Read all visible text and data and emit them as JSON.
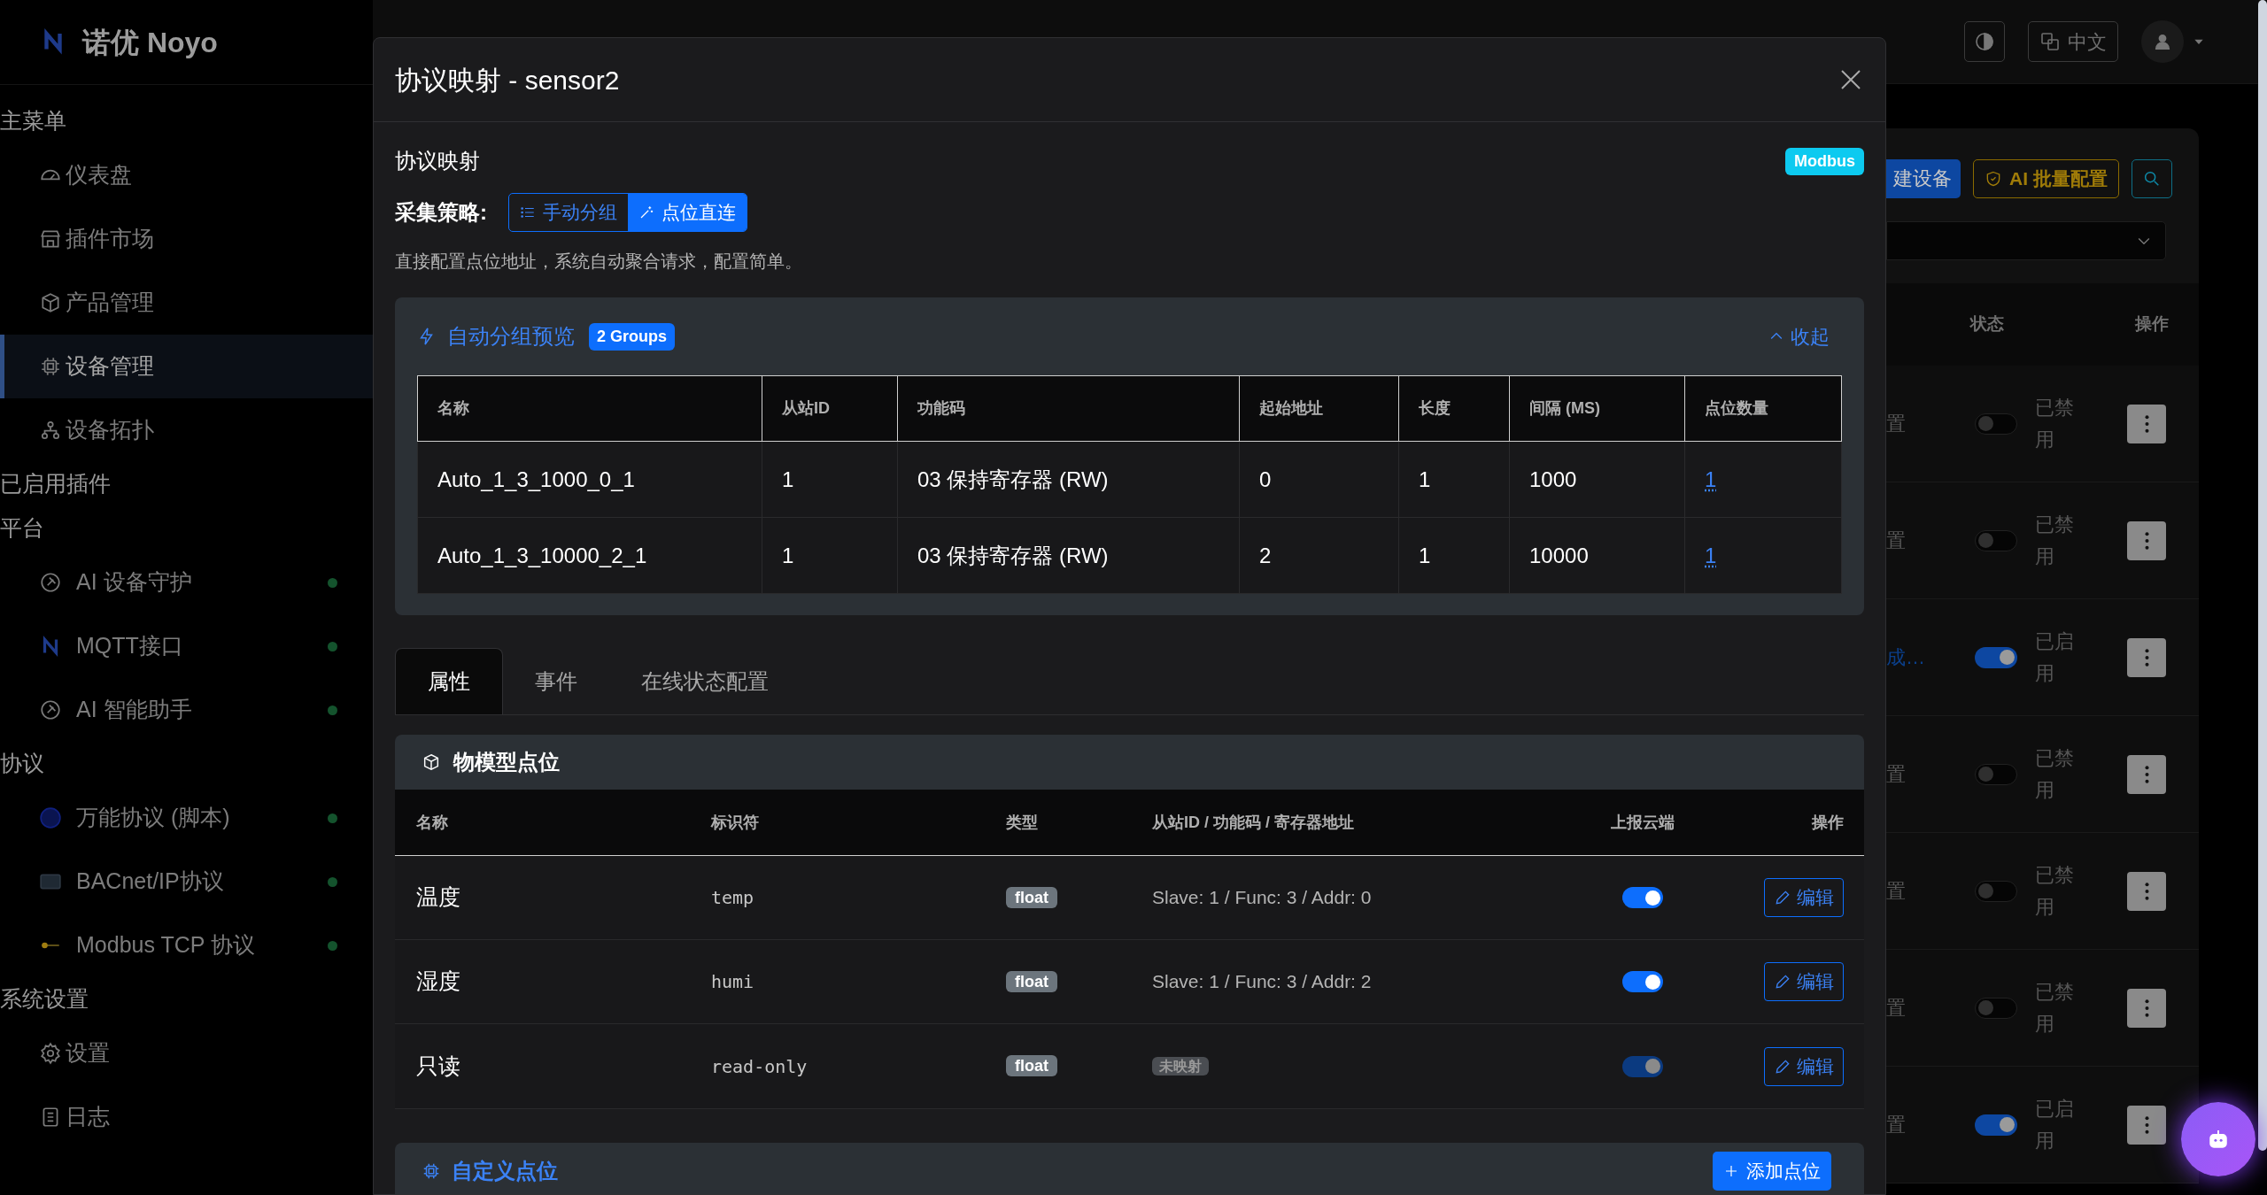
{
  "sidebar": {
    "brand": "诺优 Noyo",
    "sections": [
      {
        "title": "主菜单",
        "items": [
          {
            "label": "仪表盘",
            "selected": false
          },
          {
            "label": "插件市场",
            "selected": false
          },
          {
            "label": "产品管理",
            "selected": false
          },
          {
            "label": "设备管理",
            "selected": true
          },
          {
            "label": "设备拓扑",
            "selected": false
          }
        ]
      },
      {
        "title": "已启用插件"
      },
      {
        "title": "平台",
        "items": [
          {
            "label": "AI 设备守护",
            "selected": false,
            "online": true
          },
          {
            "label": "MQTT接口",
            "selected": false,
            "online": true
          },
          {
            "label": "AI 智能助手",
            "selected": false,
            "online": true
          }
        ]
      },
      {
        "title": "协议",
        "items": [
          {
            "label": "万能协议 (脚本)",
            "selected": false,
            "online": true
          },
          {
            "label": "BACnet/IP协议",
            "selected": false,
            "online": true
          },
          {
            "label": "Modbus TCP 协议",
            "selected": false,
            "online": true
          }
        ]
      },
      {
        "title": "系统设置",
        "items": [
          {
            "label": "设置",
            "selected": false
          },
          {
            "label": "日志",
            "selected": false
          }
        ]
      }
    ]
  },
  "topbar": {
    "language": "中文"
  },
  "device_page": {
    "buttons": [
      {
        "label": "建设备",
        "kind": "primary"
      },
      {
        "label": "AI 批量配置",
        "kind": "warning"
      }
    ],
    "columns": [
      "状态",
      "操作"
    ],
    "rows": [
      {
        "config": "置",
        "kind": "text",
        "status_on": false,
        "status": "已禁用"
      },
      {
        "config": "置",
        "kind": "text",
        "status_on": false,
        "status": "已禁用"
      },
      {
        "config": "成…",
        "kind": "link",
        "status_on": true,
        "status": "已启用"
      },
      {
        "config": "置",
        "kind": "text",
        "status_on": false,
        "status": "已禁用"
      },
      {
        "config": "置",
        "kind": "text",
        "status_on": false,
        "status": "已禁用"
      },
      {
        "config": "置",
        "kind": "text",
        "status_on": false,
        "status": "已禁用"
      },
      {
        "config": "置",
        "kind": "text",
        "status_on": true,
        "status": "已启用"
      }
    ]
  },
  "modal": {
    "title": "协议映射 - sensor2",
    "section_title": "协议映射",
    "protocol_badge": "Modbus",
    "strategy_label": "采集策略:",
    "strategies": [
      {
        "label": "手动分组",
        "selected": false
      },
      {
        "label": "点位直连",
        "selected": true
      }
    ],
    "description": "直接配置点位地址，系统自动聚合请求，配置简单。",
    "preview": {
      "title": "自动分组预览",
      "badge": "2 Groups",
      "collapse": "收起",
      "expanded": true,
      "columns": [
        "名称",
        "从站ID",
        "功能码",
        "起始地址",
        "长度",
        "间隔 (MS)",
        "点位数量"
      ],
      "rows": [
        [
          "Auto_1_3_1000_0_1",
          "1",
          "03 保持寄存器 (RW)",
          "0",
          "1",
          "1000",
          "1"
        ],
        [
          "Auto_1_3_10000_2_1",
          "1",
          "03 保持寄存器 (RW)",
          "2",
          "1",
          "10000",
          "1"
        ]
      ]
    },
    "tabs": [
      {
        "label": "属性",
        "selected": true
      },
      {
        "label": "事件",
        "selected": false
      },
      {
        "label": "在线状态配置",
        "selected": false
      }
    ],
    "points": {
      "title": "物模型点位",
      "columns": [
        "名称",
        "标识符",
        "类型",
        "从站ID / 功能码 / 寄存器地址",
        "上报云端",
        "操作"
      ],
      "rows": [
        {
          "name": "温度",
          "identifier": "temp",
          "type": "float",
          "mapping": "Slave: 1 / Func: 3 / Addr: 0",
          "mapped": true,
          "report": true,
          "disabled": false,
          "action": "编辑"
        },
        {
          "name": "湿度",
          "identifier": "humi",
          "type": "float",
          "mapping": "Slave: 1 / Func: 3 / Addr: 2",
          "mapped": true,
          "report": true,
          "disabled": false,
          "action": "编辑"
        },
        {
          "name": "只读",
          "identifier": "read-only",
          "type": "float",
          "mapping": "未映射",
          "mapped": false,
          "report": true,
          "disabled": true,
          "action": "编辑"
        }
      ]
    },
    "custom": {
      "title": "自定义点位",
      "add_button": "添加点位"
    }
  }
}
